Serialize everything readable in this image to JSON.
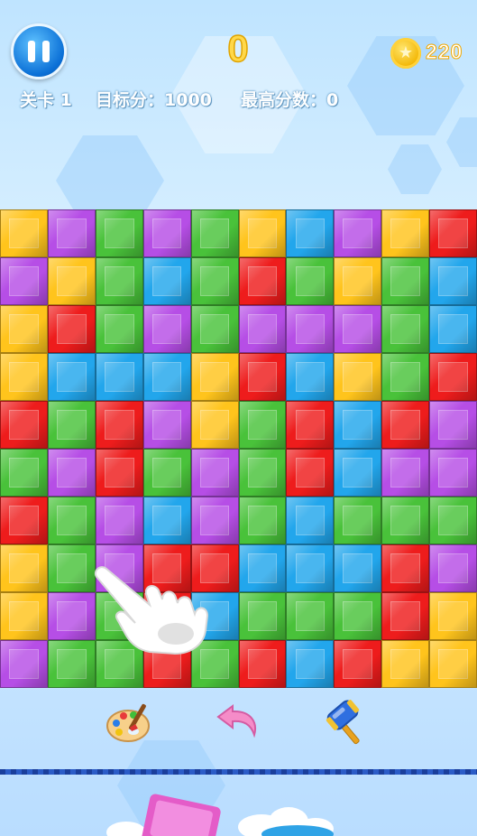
{
  "hud": {
    "score": "0",
    "coins": "220",
    "level": "关卡 1",
    "target": "目标分：1000",
    "best": "最高分数：0"
  },
  "icons": {
    "pause": "pause-icon",
    "coin": "star-coin-icon",
    "hand": "pointing-hand-icon",
    "paint": "paint-palette-icon",
    "undo": "undo-arrow-icon",
    "hammer": "hammer-icon"
  },
  "colors": {
    "y": "#ffc41c",
    "p": "#b64ee6",
    "g": "#49c23a",
    "b": "#22a6ec",
    "r": "#ee1c1c"
  },
  "board": [
    "ypgpgybpyr",
    "pygbgrgygb",
    "yrgpgpppgb",
    "ybbbyrbygr",
    "rgrpygrbrp",
    "gprgpgrbpp",
    "rgpbpgbggg",
    "ygprrbbbrp",
    "ypgrbgggry",
    "pggrgrbryy"
  ]
}
